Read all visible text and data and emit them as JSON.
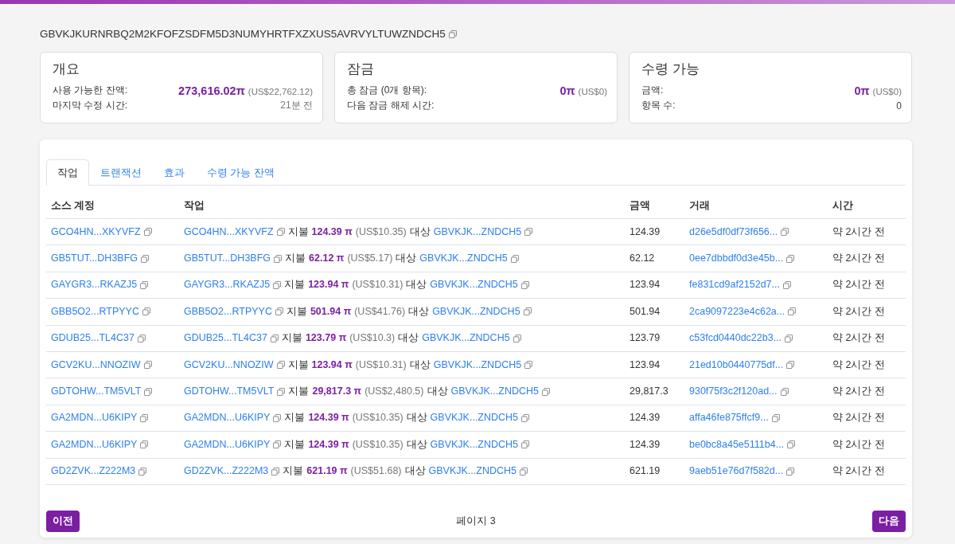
{
  "account": {
    "address": "GBVKJKURNRBQ2M2KFOFZSDFM5D3NUMYHRTFXZXUS5AVRVYLTUWZNDCH5"
  },
  "summary_cards": [
    {
      "title": "개요",
      "rows": [
        {
          "kind": "amount",
          "label": "사용 가능한 잔액:",
          "amount": "273,616.02π",
          "usd": "(US$22,762.12)"
        },
        {
          "kind": "time",
          "label": "마지막 수정 시간:",
          "value": "21분 전"
        }
      ]
    },
    {
      "title": "잠금",
      "rows": [
        {
          "kind": "amount",
          "label": "총 잠금 (0개 항목):",
          "amount": "0π",
          "usd": "(US$0)"
        },
        {
          "kind": "time",
          "label": "다음 잠금 해제 시간:"
        }
      ]
    },
    {
      "title": "수령 가능",
      "rows": [
        {
          "kind": "amount",
          "label": "금액:",
          "amount": "0π",
          "usd": "(US$0)"
        },
        {
          "kind": "count",
          "label": "항목 수:",
          "value": "0"
        }
      ]
    }
  ],
  "tabs": [
    {
      "label": "작업",
      "selected": true
    },
    {
      "label": "트랜잭션",
      "selected": false
    },
    {
      "label": "효과",
      "selected": false
    },
    {
      "label": "수령 가능 잔액",
      "selected": false
    }
  ],
  "table": {
    "columns": [
      "소스 계정",
      "작업",
      "금액",
      "거래",
      "시간"
    ],
    "rows": [
      {
        "source": "GCO4HN...XKYVFZ",
        "operation": {
          "from": "GCO4HN...XKYVFZ",
          "type": "지불",
          "amount": "124.39 π",
          "usd": "(US$10.35)",
          "target_label": "대상",
          "to": "GBVKJK...ZNDCH5"
        },
        "amount": "124.39",
        "transaction": "d26e5df0df73f656...",
        "time": "약 2시간 전"
      },
      {
        "source": "GB5TUT...DH3BFG",
        "operation": {
          "from": "GB5TUT...DH3BFG",
          "type": "지불",
          "amount": "62.12 π",
          "usd": "(US$5.17)",
          "target_label": "대상",
          "to": "GBVKJK...ZNDCH5"
        },
        "amount": "62.12",
        "transaction": "0ee7dbbdf0d3e45b...",
        "time": "약 2시간 전"
      },
      {
        "source": "GAYGR3...RKAZJ5",
        "operation": {
          "from": "GAYGR3...RKAZJ5",
          "type": "지불",
          "amount": "123.94 π",
          "usd": "(US$10.31)",
          "target_label": "대상",
          "to": "GBVKJK...ZNDCH5"
        },
        "amount": "123.94",
        "transaction": "fe831cd9af2152d7...",
        "time": "약 2시간 전"
      },
      {
        "source": "GBB5O2...RTPYYC",
        "operation": {
          "from": "GBB5O2...RTPYYC",
          "type": "지불",
          "amount": "501.94 π",
          "usd": "(US$41.76)",
          "target_label": "대상",
          "to": "GBVKJK...ZNDCH5"
        },
        "amount": "501.94",
        "transaction": "2ca9097223e4c62a...",
        "time": "약 2시간 전"
      },
      {
        "source": "GDUB25...TL4C37",
        "operation": {
          "from": "GDUB25...TL4C37",
          "type": "지불",
          "amount": "123.79 π",
          "usd": "(US$10.3)",
          "target_label": "대상",
          "to": "GBVKJK...ZNDCH5"
        },
        "amount": "123.79",
        "transaction": "c53fcd0440dc22b3...",
        "time": "약 2시간 전"
      },
      {
        "source": "GCV2KU...NNOZIW",
        "operation": {
          "from": "GCV2KU...NNOZIW",
          "type": "지불",
          "amount": "123.94 π",
          "usd": "(US$10.31)",
          "target_label": "대상",
          "to": "GBVKJK...ZNDCH5"
        },
        "amount": "123.94",
        "transaction": "21ed10b0440775df...",
        "time": "약 2시간 전"
      },
      {
        "source": "GDTOHW...TM5VLT",
        "operation": {
          "from": "GDTOHW...TM5VLT",
          "type": "지불",
          "amount": "29,817.3 π",
          "usd": "(US$2,480.5)",
          "target_label": "대상",
          "to": "GBVKJK...ZNDCH5"
        },
        "amount": "29,817.3",
        "transaction": "930f75f3c2f120ad...",
        "time": "약 2시간 전"
      },
      {
        "source": "GA2MDN...U6KIPY",
        "operation": {
          "from": "GA2MDN...U6KIPY",
          "type": "지불",
          "amount": "124.39 π",
          "usd": "(US$10.35)",
          "target_label": "대상",
          "to": "GBVKJK...ZNDCH5"
        },
        "amount": "124.39",
        "transaction": "affa46fe875ffcf9...",
        "time": "약 2시간 전"
      },
      {
        "source": "GA2MDN...U6KIPY",
        "operation": {
          "from": "GA2MDN...U6KIPY",
          "type": "지불",
          "amount": "124.39 π",
          "usd": "(US$10.35)",
          "target_label": "대상",
          "to": "GBVKJK...ZNDCH5"
        },
        "amount": "124.39",
        "transaction": "be0bc8a45e5111b4...",
        "time": "약 2시간 전"
      },
      {
        "source": "GD2ZVK...Z222M3",
        "operation": {
          "from": "GD2ZVK...Z222M3",
          "type": "지불",
          "amount": "621.19 π",
          "usd": "(US$51.68)",
          "target_label": "대상",
          "to": "GBVKJK...ZNDCH5"
        },
        "amount": "621.19",
        "transaction": "9aeb51e76d7f582d...",
        "time": "약 2시간 전"
      }
    ]
  },
  "pagination": {
    "previous": "이전",
    "page": "페이지 3",
    "next": "다음"
  }
}
